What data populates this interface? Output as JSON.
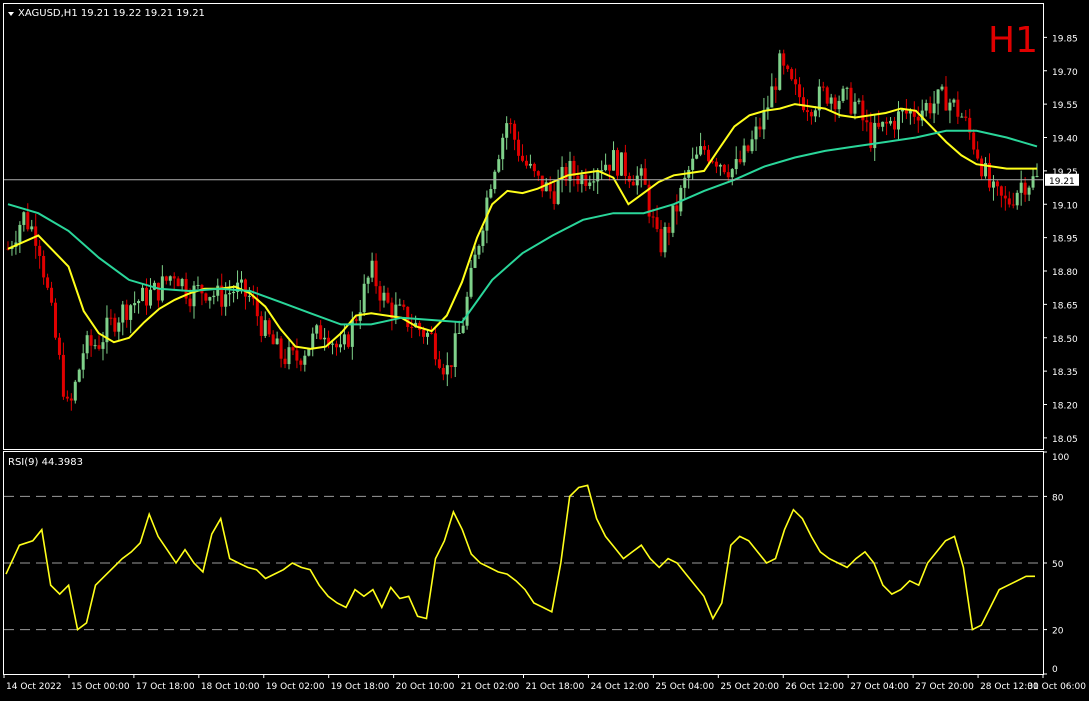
{
  "header": {
    "symbol_info": "XAGUSD,H1  19.21 19.22 19.21 19.21",
    "timeframe_badge": "H1",
    "rsi_label": "RSI(9) 44.3983"
  },
  "colors": {
    "background": "#000000",
    "axis": "#ffffff",
    "bull_candle": "#7fd18a",
    "bear_candle": "#e00000",
    "ma_fast": "#ffff1a",
    "ma_slow": "#2ad69a",
    "rsi": "#ffff1a",
    "badge": "#e00000",
    "level_line": "#9a9a9a"
  },
  "chart_data": [
    {
      "type": "candlestick",
      "title": "XAGUSD,H1",
      "ylim": [
        18.0,
        20.0
      ],
      "y_ticks": [
        "19.85",
        "19.70",
        "19.55",
        "19.40",
        "19.25",
        "19.10",
        "18.95",
        "18.80",
        "18.65",
        "18.50",
        "18.35",
        "18.20",
        "18.05"
      ],
      "x_ticks": [
        "14 Oct 2022",
        "15 Oct 00:00",
        "17 Oct 18:00",
        "18 Oct 10:00",
        "19 Oct 02:00",
        "19 Oct 18:00",
        "20 Oct 10:00",
        "21 Oct 02:00",
        "21 Oct 18:00",
        "24 Oct 12:00",
        "25 Oct 04:00",
        "25 Oct 20:00",
        "26 Oct 12:00",
        "27 Oct 04:00",
        "27 Oct 20:00",
        "28 Oct 12:00",
        "31 Oct 06:00"
      ],
      "current_price": "19.21",
      "close_path": [
        [
          0,
          18.9
        ],
        [
          2,
          19.05
        ],
        [
          4,
          18.95
        ],
        [
          6,
          18.55
        ],
        [
          8,
          18.15
        ],
        [
          10,
          18.45
        ],
        [
          12,
          18.48
        ],
        [
          14,
          18.58
        ],
        [
          16,
          18.65
        ],
        [
          18,
          18.68
        ],
        [
          20,
          18.72
        ],
        [
          22,
          18.8
        ],
        [
          24,
          18.7
        ],
        [
          26,
          18.72
        ],
        [
          28,
          18.68
        ],
        [
          30,
          18.72
        ],
        [
          32,
          18.68
        ],
        [
          34,
          18.52
        ],
        [
          36,
          18.42
        ],
        [
          38,
          18.4
        ],
        [
          40,
          18.48
        ],
        [
          42,
          18.55
        ],
        [
          44,
          18.42
        ],
        [
          46,
          18.6
        ],
        [
          48,
          18.8
        ],
        [
          50,
          18.65
        ],
        [
          52,
          18.6
        ],
        [
          54,
          18.55
        ],
        [
          56,
          18.5
        ],
        [
          58,
          18.35
        ],
        [
          60,
          18.55
        ],
        [
          62,
          18.9
        ],
        [
          64,
          19.25
        ],
        [
          66,
          19.48
        ],
        [
          68,
          19.3
        ],
        [
          70,
          19.2
        ],
        [
          72,
          19.15
        ],
        [
          74,
          19.25
        ],
        [
          76,
          19.22
        ],
        [
          78,
          19.28
        ],
        [
          80,
          19.3
        ],
        [
          82,
          19.25
        ],
        [
          84,
          19.2
        ],
        [
          86,
          18.9
        ],
        [
          88,
          19.05
        ],
        [
          90,
          19.25
        ],
        [
          92,
          19.35
        ],
        [
          94,
          19.3
        ],
        [
          96,
          19.25
        ],
        [
          98,
          19.35
        ],
        [
          100,
          19.5
        ],
        [
          102,
          19.72
        ],
        [
          104,
          19.6
        ],
        [
          106,
          19.55
        ],
        [
          108,
          19.6
        ],
        [
          110,
          19.58
        ],
        [
          112,
          19.55
        ],
        [
          114,
          19.4
        ],
        [
          116,
          19.45
        ],
        [
          118,
          19.5
        ],
        [
          120,
          19.52
        ],
        [
          122,
          19.55
        ],
        [
          124,
          19.58
        ],
        [
          126,
          19.5
        ],
        [
          128,
          19.35
        ],
        [
          130,
          19.15
        ],
        [
          132,
          19.1
        ],
        [
          134,
          19.2
        ],
        [
          136,
          19.21
        ]
      ],
      "series": [
        {
          "name": "MA fast",
          "points": [
            [
              0,
              18.9
            ],
            [
              4,
              18.96
            ],
            [
              8,
              18.82
            ],
            [
              10,
              18.62
            ],
            [
              12,
              18.52
            ],
            [
              14,
              18.48
            ],
            [
              16,
              18.5
            ],
            [
              18,
              18.57
            ],
            [
              20,
              18.63
            ],
            [
              22,
              18.67
            ],
            [
              24,
              18.7
            ],
            [
              26,
              18.72
            ],
            [
              28,
              18.72
            ],
            [
              30,
              18.73
            ],
            [
              32,
              18.7
            ],
            [
              34,
              18.64
            ],
            [
              36,
              18.54
            ],
            [
              38,
              18.46
            ],
            [
              40,
              18.45
            ],
            [
              42,
              18.46
            ],
            [
              44,
              18.52
            ],
            [
              46,
              18.6
            ],
            [
              48,
              18.61
            ],
            [
              50,
              18.6
            ],
            [
              52,
              18.59
            ],
            [
              54,
              18.55
            ],
            [
              56,
              18.53
            ],
            [
              58,
              18.6
            ],
            [
              60,
              18.75
            ],
            [
              62,
              18.95
            ],
            [
              64,
              19.1
            ],
            [
              66,
              19.16
            ],
            [
              68,
              19.15
            ],
            [
              70,
              19.17
            ],
            [
              72,
              19.2
            ],
            [
              74,
              19.23
            ],
            [
              76,
              19.24
            ],
            [
              78,
              19.25
            ],
            [
              80,
              19.22
            ],
            [
              82,
              19.1
            ],
            [
              84,
              19.15
            ],
            [
              86,
              19.2
            ],
            [
              88,
              19.23
            ],
            [
              90,
              19.24
            ],
            [
              92,
              19.25
            ],
            [
              94,
              19.35
            ],
            [
              96,
              19.45
            ],
            [
              98,
              19.5
            ],
            [
              100,
              19.52
            ],
            [
              102,
              19.53
            ],
            [
              104,
              19.55
            ],
            [
              106,
              19.54
            ],
            [
              108,
              19.53
            ],
            [
              110,
              19.5
            ],
            [
              112,
              19.49
            ],
            [
              114,
              19.5
            ],
            [
              116,
              19.51
            ],
            [
              118,
              19.53
            ],
            [
              120,
              19.52
            ],
            [
              122,
              19.45
            ],
            [
              124,
              19.38
            ],
            [
              126,
              19.32
            ],
            [
              128,
              19.28
            ],
            [
              130,
              19.27
            ],
            [
              132,
              19.26
            ],
            [
              134,
              19.26
            ],
            [
              136,
              19.26
            ]
          ]
        },
        {
          "name": "MA slow",
          "points": [
            [
              0,
              19.1
            ],
            [
              4,
              19.06
            ],
            [
              8,
              18.98
            ],
            [
              12,
              18.86
            ],
            [
              16,
              18.76
            ],
            [
              20,
              18.72
            ],
            [
              24,
              18.71
            ],
            [
              28,
              18.72
            ],
            [
              32,
              18.71
            ],
            [
              36,
              18.66
            ],
            [
              40,
              18.61
            ],
            [
              44,
              18.56
            ],
            [
              48,
              18.56
            ],
            [
              52,
              18.59
            ],
            [
              56,
              18.58
            ],
            [
              60,
              18.57
            ],
            [
              64,
              18.76
            ],
            [
              68,
              18.88
            ],
            [
              72,
              18.96
            ],
            [
              76,
              19.03
            ],
            [
              80,
              19.06
            ],
            [
              84,
              19.06
            ],
            [
              88,
              19.1
            ],
            [
              92,
              19.16
            ],
            [
              96,
              19.21
            ],
            [
              100,
              19.27
            ],
            [
              104,
              19.31
            ],
            [
              108,
              19.34
            ],
            [
              112,
              19.36
            ],
            [
              116,
              19.38
            ],
            [
              120,
              19.4
            ],
            [
              124,
              19.43
            ],
            [
              128,
              19.43
            ],
            [
              132,
              19.4
            ],
            [
              136,
              19.36
            ]
          ]
        }
      ]
    },
    {
      "type": "line",
      "title": "RSI(9) 44.3983",
      "ylim": [
        0,
        100
      ],
      "y_ticks": [
        "100",
        "80",
        "50",
        "20",
        "0"
      ],
      "levels": [
        80,
        50,
        20
      ],
      "series": [
        {
          "name": "RSI(9)",
          "points": [
            [
              0,
              45
            ],
            [
              3,
              58
            ],
            [
              6,
              60
            ],
            [
              8,
              65
            ],
            [
              10,
              40
            ],
            [
              12,
              36
            ],
            [
              14,
              40
            ],
            [
              16,
              20
            ],
            [
              18,
              23
            ],
            [
              20,
              40
            ],
            [
              22,
              44
            ],
            [
              24,
              48
            ],
            [
              26,
              52
            ],
            [
              28,
              55
            ],
            [
              30,
              59
            ],
            [
              32,
              72
            ],
            [
              34,
              62
            ],
            [
              36,
              56
            ],
            [
              38,
              50
            ],
            [
              40,
              56
            ],
            [
              42,
              50
            ],
            [
              44,
              46
            ],
            [
              46,
              63
            ],
            [
              48,
              70
            ],
            [
              50,
              52
            ],
            [
              52,
              50
            ],
            [
              54,
              48
            ],
            [
              56,
              47
            ],
            [
              58,
              43
            ],
            [
              60,
              45
            ],
            [
              62,
              47
            ],
            [
              64,
              50
            ],
            [
              66,
              48
            ],
            [
              68,
              47
            ],
            [
              70,
              40
            ],
            [
              72,
              35
            ],
            [
              74,
              32
            ],
            [
              76,
              30
            ],
            [
              78,
              38
            ],
            [
              80,
              35
            ],
            [
              82,
              38
            ],
            [
              84,
              30
            ],
            [
              86,
              39
            ],
            [
              88,
              34
            ],
            [
              90,
              35
            ],
            [
              92,
              26
            ],
            [
              94,
              25
            ],
            [
              96,
              52
            ],
            [
              98,
              60
            ],
            [
              100,
              73
            ],
            [
              102,
              65
            ],
            [
              104,
              54
            ],
            [
              106,
              50
            ],
            [
              108,
              48
            ],
            [
              110,
              46
            ],
            [
              112,
              45
            ],
            [
              114,
              42
            ],
            [
              116,
              38
            ],
            [
              118,
              32
            ],
            [
              120,
              30
            ],
            [
              122,
              28
            ],
            [
              124,
              50
            ],
            [
              126,
              80
            ],
            [
              128,
              84
            ],
            [
              130,
              85
            ],
            [
              132,
              70
            ],
            [
              134,
              62
            ],
            [
              136,
              57
            ],
            [
              138,
              52
            ],
            [
              140,
              55
            ],
            [
              142,
              58
            ],
            [
              144,
              52
            ],
            [
              146,
              48
            ],
            [
              148,
              52
            ],
            [
              150,
              50
            ],
            [
              152,
              45
            ],
            [
              154,
              40
            ],
            [
              156,
              35
            ],
            [
              158,
              25
            ],
            [
              160,
              32
            ],
            [
              162,
              58
            ],
            [
              164,
              62
            ],
            [
              166,
              60
            ],
            [
              168,
              55
            ],
            [
              170,
              50
            ],
            [
              172,
              52
            ],
            [
              174,
              65
            ],
            [
              176,
              74
            ],
            [
              178,
              70
            ],
            [
              180,
              62
            ],
            [
              182,
              55
            ],
            [
              184,
              52
            ],
            [
              186,
              50
            ],
            [
              188,
              48
            ],
            [
              190,
              52
            ],
            [
              192,
              55
            ],
            [
              194,
              50
            ],
            [
              196,
              40
            ],
            [
              198,
              36
            ],
            [
              200,
              38
            ],
            [
              202,
              42
            ],
            [
              204,
              40
            ],
            [
              206,
              50
            ],
            [
              208,
              55
            ],
            [
              210,
              60
            ],
            [
              212,
              62
            ],
            [
              214,
              48
            ],
            [
              216,
              20
            ],
            [
              218,
              22
            ],
            [
              220,
              30
            ],
            [
              222,
              38
            ],
            [
              224,
              40
            ],
            [
              226,
              42
            ],
            [
              228,
              44
            ],
            [
              230,
              44
            ]
          ]
        }
      ]
    }
  ]
}
